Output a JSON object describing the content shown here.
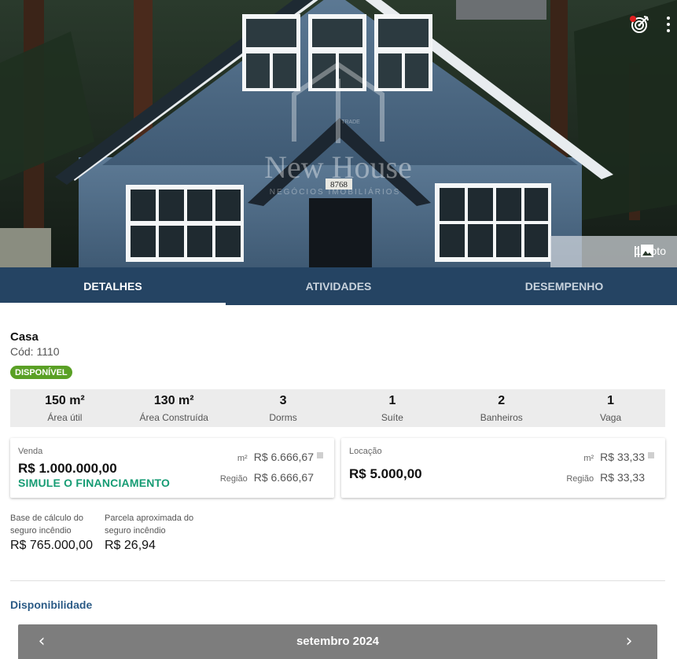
{
  "hero": {
    "photo_count_label": "1 Foto",
    "house_number": "8768",
    "watermark_brand": "New House",
    "watermark_sub": "NEGÓCIOS IMOBILIÁRIOS",
    "watermark_est": "TRADE"
  },
  "tabs": [
    {
      "label": "DETALHES",
      "active": true
    },
    {
      "label": "ATIVIDADES",
      "active": false
    },
    {
      "label": "DESEMPENHO",
      "active": false
    }
  ],
  "property": {
    "type": "Casa",
    "code": "Cód: 1110",
    "status": "DISPONÍVEL",
    "status_color": "#5aa025"
  },
  "stats": [
    {
      "value": "150 m²",
      "label": "Área útil"
    },
    {
      "value": "130 m²",
      "label": "Área Construída"
    },
    {
      "value": "3",
      "label": "Dorms"
    },
    {
      "value": "1",
      "label": "Suíte"
    },
    {
      "value": "2",
      "label": "Banheiros"
    },
    {
      "value": "1",
      "label": "Vaga"
    }
  ],
  "sale": {
    "label": "Venda",
    "price": "R$ 1.000.000,00",
    "link": "SIMULE O FINANCIAMENTO",
    "m2_key": "m²",
    "m2_value": "R$ 6.666,67",
    "region_key": "Região",
    "region_value": "R$ 6.666,67"
  },
  "rent": {
    "label": "Locação",
    "price": "R$ 5.000,00",
    "m2_key": "m²",
    "m2_value": "R$ 33,33",
    "region_key": "Região",
    "region_value": "R$ 33,33"
  },
  "insurance": {
    "base_label": "Base de cálculo do seguro incêndio",
    "base_value": "R$ 765.000,00",
    "installment_label": "Parcela aproximada do seguro incêndio",
    "installment_value": "R$ 26,94"
  },
  "availability": {
    "title": "Disponibilidade",
    "month": "setembro 2024",
    "prev": "‹",
    "next": "›"
  },
  "colors": {
    "tab_bar": "#254463",
    "link": "#169c74",
    "section_title": "#2b5b86"
  },
  "icons": {
    "target": "target-icon",
    "more": "more-vert-icon",
    "photos": "photo-library-icon"
  }
}
